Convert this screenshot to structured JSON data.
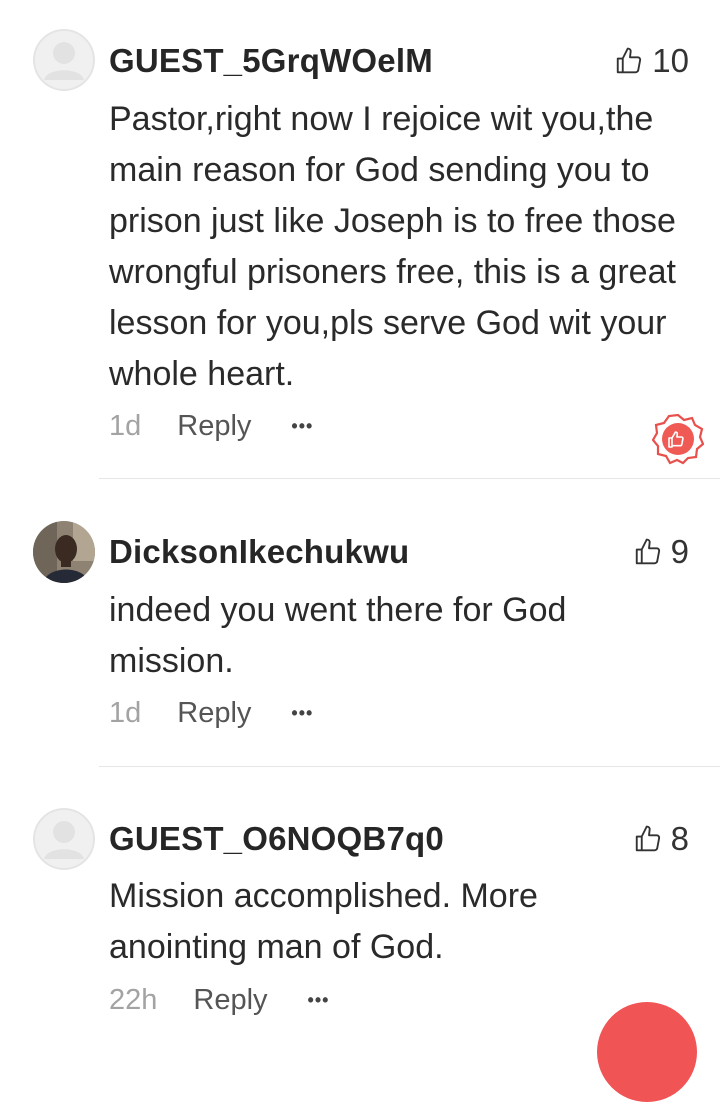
{
  "comments": [
    {
      "username": "GUEST_5GrqWOelM",
      "likes": "10",
      "text": "Pastor,right now I rejoice wit you,the main reason for God sending you to prison just like Joseph is to free those wrongful prisoners free, this is a great lesson for you,pls serve God wit your whole heart.",
      "time": "1d",
      "reply_label": "Reply",
      "more_label": "•••",
      "avatar": "default-user-icon"
    },
    {
      "username": "DicksonIkechukwu",
      "likes": "9",
      "text": "indeed you went there for God mission.",
      "time": "1d",
      "reply_label": "Reply",
      "more_label": "•••",
      "avatar": "user-photo"
    },
    {
      "username": "GUEST_O6NOQB7q0",
      "likes": "8",
      "text": "Mission accomplished. More anointing man of God.",
      "time": "22h",
      "reply_label": "Reply",
      "more_label": "•••",
      "avatar": "default-user-icon"
    }
  ],
  "colors": {
    "accent": "#f05454",
    "muted": "#a3a3a3",
    "divider": "#e6e6e6"
  },
  "icons": {
    "like": "thumbs-up-icon",
    "badge": "top-fan-badge-icon",
    "fab": "compose-fab"
  }
}
